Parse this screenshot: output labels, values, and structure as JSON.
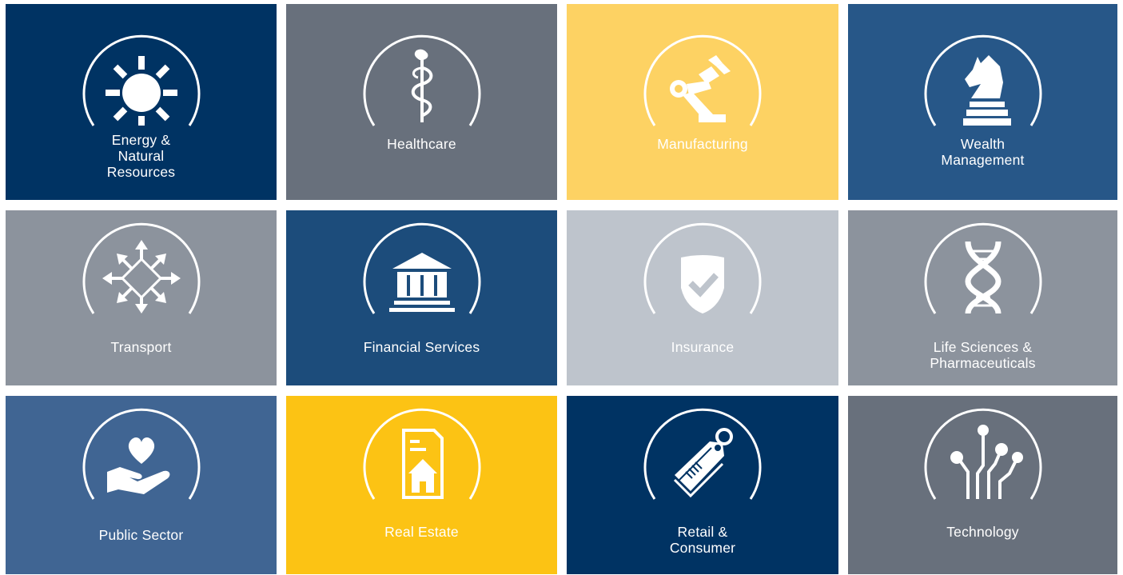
{
  "tiles": [
    {
      "label": "Energy &\nNatural\nResources",
      "color": "#003363",
      "icon": "sun-icon"
    },
    {
      "label": "Healthcare",
      "color": "#68707c",
      "icon": "caduceus-icon"
    },
    {
      "label": "Manufacturing",
      "color": "#fdd263",
      "icon": "robot-arm-icon"
    },
    {
      "label": "Wealth\nManagement",
      "color": "#275788",
      "icon": "chess-knight-icon"
    },
    {
      "label": "Transport",
      "color": "#8c939d",
      "icon": "arrows-icon"
    },
    {
      "label": "Financial Services",
      "color": "#1c4c7b",
      "icon": "bank-icon"
    },
    {
      "label": "Insurance",
      "color": "#bec4cc",
      "icon": "shield-check-icon"
    },
    {
      "label": "Life Sciences &\nPharmaceuticals",
      "color": "#8c939d",
      "icon": "dna-icon"
    },
    {
      "label": "Public Sector",
      "color": "#406593",
      "icon": "hand-heart-icon"
    },
    {
      "label": "Real Estate",
      "color": "#fcc314",
      "icon": "property-document-icon"
    },
    {
      "label": "Retail &\nConsumer",
      "color": "#003363",
      "icon": "price-tag-icon"
    },
    {
      "label": "Technology",
      "color": "#68707c",
      "icon": "circuit-icon"
    }
  ]
}
